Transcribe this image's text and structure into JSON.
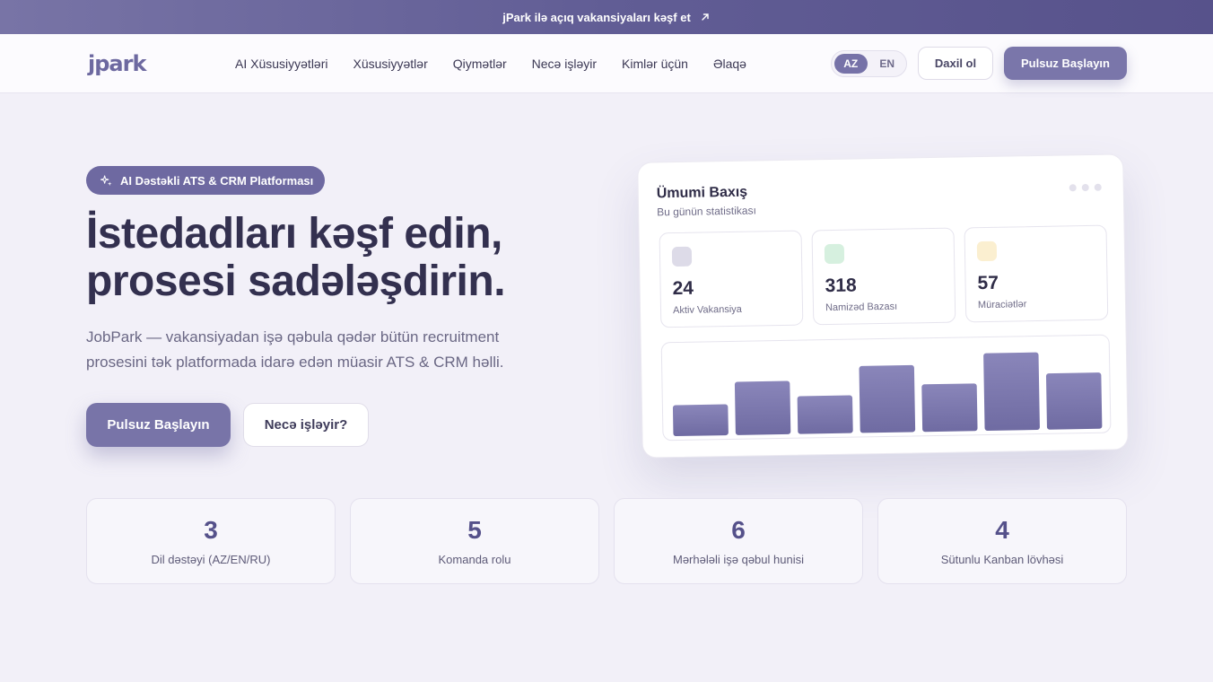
{
  "announcement": {
    "text": "jPark ilə açıq vakansiyaları kəşf et",
    "icon": "arrow-up-right-icon"
  },
  "nav": {
    "logo_text": "jpark",
    "links": [
      "AI Xüsusiyyətləri",
      "Xüsusiyyətlər",
      "Qiymətlər",
      "Necə işləyir",
      "Kimlər üçün",
      "Əlaqə"
    ],
    "lang": {
      "active": "AZ",
      "other": "EN"
    },
    "login_label": "Daxil ol",
    "start_label": "Pulsuz Başlayın"
  },
  "hero": {
    "badge": "AI Dəstəkli ATS & CRM Platforması",
    "badge_icon": "sparkle-icon",
    "title_lines": [
      "İstedadları kəşf edin,",
      "prosesi sadələşdirin."
    ],
    "desc_lines": [
      "JobPark — vakansiyadan işə qəbula qədər bütün recruitment",
      "prosesini tək platformada idarə edən müasir ATS & CRM həlli."
    ],
    "primary_cta": "Pulsuz Başlayın",
    "secondary_cta": "Necə işləyir?"
  },
  "dashboard": {
    "title": "Ümumi Baxış",
    "subtitle": "Bu günün statistikası",
    "stats": [
      {
        "value": "24",
        "label": "Aktiv Vakansiya",
        "color": "#dddbe8"
      },
      {
        "value": "318",
        "label": "Namizəd Bazası",
        "color": "#d6f0df"
      },
      {
        "value": "57",
        "label": "Müraciətlər",
        "color": "#fbefd0"
      }
    ]
  },
  "chart_data": {
    "type": "bar",
    "values": [
      32,
      55,
      39,
      69,
      49,
      80,
      58
    ],
    "ylim": [
      0,
      100
    ],
    "color": "#7570a8"
  },
  "stats": [
    {
      "value": "3",
      "label": "Dil dəstəyi (AZ/EN/RU)"
    },
    {
      "value": "5",
      "label": "Komanda rolu"
    },
    {
      "value": "6",
      "label": "Mərhələli işə qəbul hunisi"
    },
    {
      "value": "4",
      "label": "Sütunlu Kanban lövhəsi"
    }
  ],
  "colors": {
    "accent": "#7874a8",
    "title": "#33304f",
    "stat_number": "#55518a"
  }
}
